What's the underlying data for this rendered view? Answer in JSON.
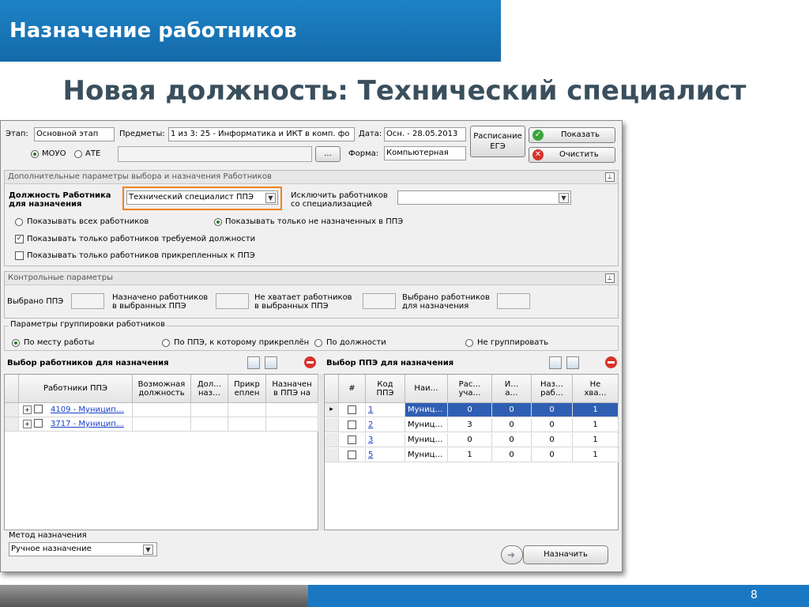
{
  "slide": {
    "header": "Назначение работников",
    "title": "Новая должность: Технический специалист",
    "page_number": "8"
  },
  "top": {
    "stage_label": "Этап:",
    "stage_value": "Основной этап",
    "subjects_label": "Предметы:",
    "subjects_value": "1 из 3: 25 - Информатика и ИКТ в комп. фо",
    "date_label": "Дата:",
    "date_value": "Осн. - 28.05.2013",
    "schedule_button": "Расписание\nЕГЭ",
    "show_button": "Показать",
    "clear_button": "Очистить",
    "radio_mouo": "МОУО",
    "radio_ate": "АТЕ",
    "ellipsis_button": "...",
    "form_label": "Форма:",
    "form_value": "Компьютерная"
  },
  "extra_params": {
    "header": "Дополнительные параметры выбора и назначения Работников",
    "position_label": "Должность Работника\nдля назначения",
    "position_value": "Технический специалист ППЭ",
    "exclude_label": "Исключить работников\nсо специализацией",
    "exclude_value": "",
    "radio_all": "Показывать всех работников",
    "radio_unassigned": "Показывать только не назначенных в ППЭ",
    "chk_required": "Показывать только работников требуемой должности",
    "chk_attached": "Показывать только работников прикрепленных к ППЭ"
  },
  "control_params": {
    "header": "Контрольные параметры",
    "selected_ppe": "Выбрано ППЭ",
    "assigned": "Назначено работников\nв выбранных ППЭ",
    "missing": "Не хватает работников\nв выбранных ППЭ",
    "selected_workers": "Выбрано работников\nдля назначения"
  },
  "grouping": {
    "legend": "Параметры группировки работников",
    "options": [
      "По месту работы",
      "По ППЭ, к которому прикреплён",
      "По должности",
      "Не группировать"
    ],
    "selected_index": 0
  },
  "workers_grid": {
    "title": "Выбор работников для назначения",
    "columns": [
      "Работники ППЭ",
      "Возможная\nдолжность",
      "Дол…\nназ…",
      "Прикр\nеплен",
      "Назначен\nв ППЭ на"
    ],
    "rows": [
      {
        "name": "4109 - Муницип…"
      },
      {
        "name": "3717 - Муницип…"
      }
    ]
  },
  "ppe_grid": {
    "title": "Выбор ППЭ для назначения",
    "columns": [
      "#",
      "Код\nППЭ",
      "Наи…",
      "Рас…\nуча…",
      "И…\nа…",
      "Наз…\nраб…",
      "Не\nхва…"
    ],
    "rows": [
      {
        "code": "1",
        "name": "Муниц…",
        "c1": "0",
        "c2": "0",
        "c3": "0",
        "c4": "1",
        "selected": true
      },
      {
        "code": "2",
        "name": "Муниц…",
        "c1": "3",
        "c2": "0",
        "c3": "0",
        "c4": "1",
        "selected": false
      },
      {
        "code": "3",
        "name": "Муниц…",
        "c1": "0",
        "c2": "0",
        "c3": "0",
        "c4": "1",
        "selected": false
      },
      {
        "code": "5",
        "name": "Муниц…",
        "c1": "1",
        "c2": "0",
        "c3": "0",
        "c4": "1",
        "selected": false
      }
    ]
  },
  "bottom": {
    "method_label": "Метод назначения",
    "method_value": "Ручное назначение",
    "assign_button": "Назначить"
  },
  "colors": {
    "header_blue": "#1a78c2",
    "title_gray": "#3a4f5d",
    "highlight_orange": "#f0821e",
    "selection_blue": "#2f5fb3",
    "link_blue": "#1a3fc9"
  }
}
